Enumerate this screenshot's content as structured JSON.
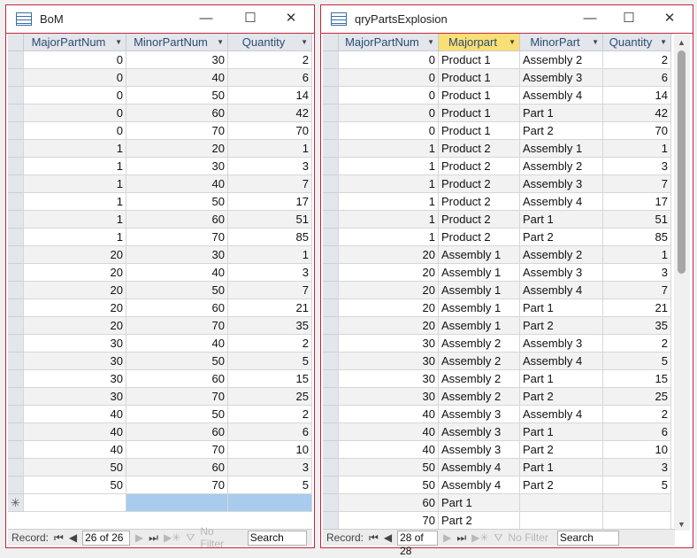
{
  "bom": {
    "title": "BoM",
    "columns": [
      "MajorPartNum",
      "MinorPartNum",
      "Quantity"
    ],
    "rows": [
      [
        0,
        30,
        2
      ],
      [
        0,
        40,
        6
      ],
      [
        0,
        50,
        14
      ],
      [
        0,
        60,
        42
      ],
      [
        0,
        70,
        70
      ],
      [
        1,
        20,
        1
      ],
      [
        1,
        30,
        3
      ],
      [
        1,
        40,
        7
      ],
      [
        1,
        50,
        17
      ],
      [
        1,
        60,
        51
      ],
      [
        1,
        70,
        85
      ],
      [
        20,
        30,
        1
      ],
      [
        20,
        40,
        3
      ],
      [
        20,
        50,
        7
      ],
      [
        20,
        60,
        21
      ],
      [
        20,
        70,
        35
      ],
      [
        30,
        40,
        2
      ],
      [
        30,
        50,
        5
      ],
      [
        30,
        60,
        15
      ],
      [
        30,
        70,
        25
      ],
      [
        40,
        50,
        2
      ],
      [
        40,
        60,
        6
      ],
      [
        40,
        70,
        10
      ],
      [
        50,
        60,
        3
      ],
      [
        50,
        70,
        5
      ]
    ],
    "new_row_marker": "✳",
    "nav": {
      "label": "Record:",
      "position": "26 of 26",
      "filter": "No Filter",
      "search": "Search"
    }
  },
  "query": {
    "title": "qryPartsExplosion",
    "columns": [
      "MajorPartNum",
      "Majorpart",
      "MinorPart",
      "Quantity"
    ],
    "rows": [
      [
        0,
        "Product 1",
        "Assembly 2",
        2
      ],
      [
        0,
        "Product 1",
        "Assembly 3",
        6
      ],
      [
        0,
        "Product 1",
        "Assembly 4",
        14
      ],
      [
        0,
        "Product 1",
        "Part 1",
        42
      ],
      [
        0,
        "Product 1",
        "Part 2",
        70
      ],
      [
        1,
        "Product 2",
        "Assembly 1",
        1
      ],
      [
        1,
        "Product 2",
        "Assembly 2",
        3
      ],
      [
        1,
        "Product 2",
        "Assembly 3",
        7
      ],
      [
        1,
        "Product 2",
        "Assembly 4",
        17
      ],
      [
        1,
        "Product 2",
        "Part 1",
        51
      ],
      [
        1,
        "Product 2",
        "Part 2",
        85
      ],
      [
        20,
        "Assembly 1",
        "Assembly 2",
        1
      ],
      [
        20,
        "Assembly 1",
        "Assembly 3",
        3
      ],
      [
        20,
        "Assembly 1",
        "Assembly 4",
        7
      ],
      [
        20,
        "Assembly 1",
        "Part 1",
        21
      ],
      [
        20,
        "Assembly 1",
        "Part 2",
        35
      ],
      [
        30,
        "Assembly 2",
        "Assembly 3",
        2
      ],
      [
        30,
        "Assembly 2",
        "Assembly 4",
        5
      ],
      [
        30,
        "Assembly 2",
        "Part 1",
        15
      ],
      [
        30,
        "Assembly 2",
        "Part 2",
        25
      ],
      [
        40,
        "Assembly 3",
        "Assembly 4",
        2
      ],
      [
        40,
        "Assembly 3",
        "Part 1",
        6
      ],
      [
        40,
        "Assembly 3",
        "Part 2",
        10
      ],
      [
        50,
        "Assembly 4",
        "Part 1",
        3
      ],
      [
        50,
        "Assembly 4",
        "Part 2",
        5
      ],
      [
        60,
        "Part 1",
        "",
        ""
      ],
      [
        70,
        "Part 2",
        "",
        ""
      ]
    ],
    "nav": {
      "label": "Record:",
      "position": "28 of 28",
      "filter": "No Filter",
      "search": "Search"
    }
  },
  "window_buttons": {
    "minimize": "—",
    "maximize": "☐",
    "close": "✕"
  },
  "colors": {
    "border": "#c0283f",
    "header_highlight": "#f9df74",
    "new_row_selection": "#a8cbee"
  }
}
